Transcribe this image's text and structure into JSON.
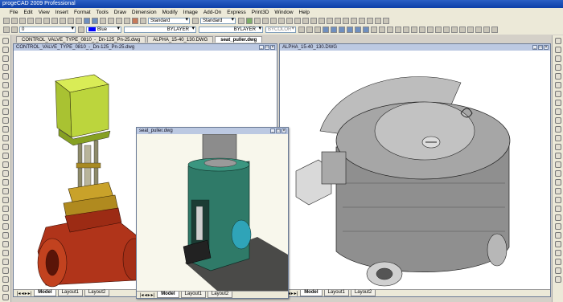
{
  "app": {
    "title": "progeCAD 2009 Professional"
  },
  "menu": [
    "File",
    "Edit",
    "View",
    "Insert",
    "Format",
    "Tools",
    "Draw",
    "Dimension",
    "Modify",
    "Image",
    "Add-On",
    "Express",
    "Print3D",
    "Window",
    "Help"
  ],
  "toolbar": {
    "layer_value": "0",
    "style1": "Standard",
    "style2": "Standard",
    "color_value": "Blue",
    "linetype_value": "BYLAYER",
    "lineweight_value": "BYLAYER",
    "plotstyle_value": "BYCOLOR"
  },
  "document_tabs": [
    "CONTROL_VALVE_TYPE_0810_-_Dn-125_Pn-25.dwg",
    "ALPHA_15-40_130.DWG",
    "seat_puller.dwg"
  ],
  "windows": {
    "left": {
      "title": "CONTROL_VALVE_TYPE_0810_-_Dn-125_Pn-25.dwg"
    },
    "right": {
      "title": "ALPHA_15-40_130.DWG"
    },
    "float": {
      "title": "seat_puller.dwg"
    }
  },
  "layout_tabs": [
    "Model",
    "Layout1",
    "Layout2"
  ],
  "colors": {
    "accent": "#0d3fa8",
    "valve_head": "#b8d23a",
    "valve_body": "#b0341a",
    "puller": "#2f7a68",
    "pump": "#9a9a9a"
  }
}
